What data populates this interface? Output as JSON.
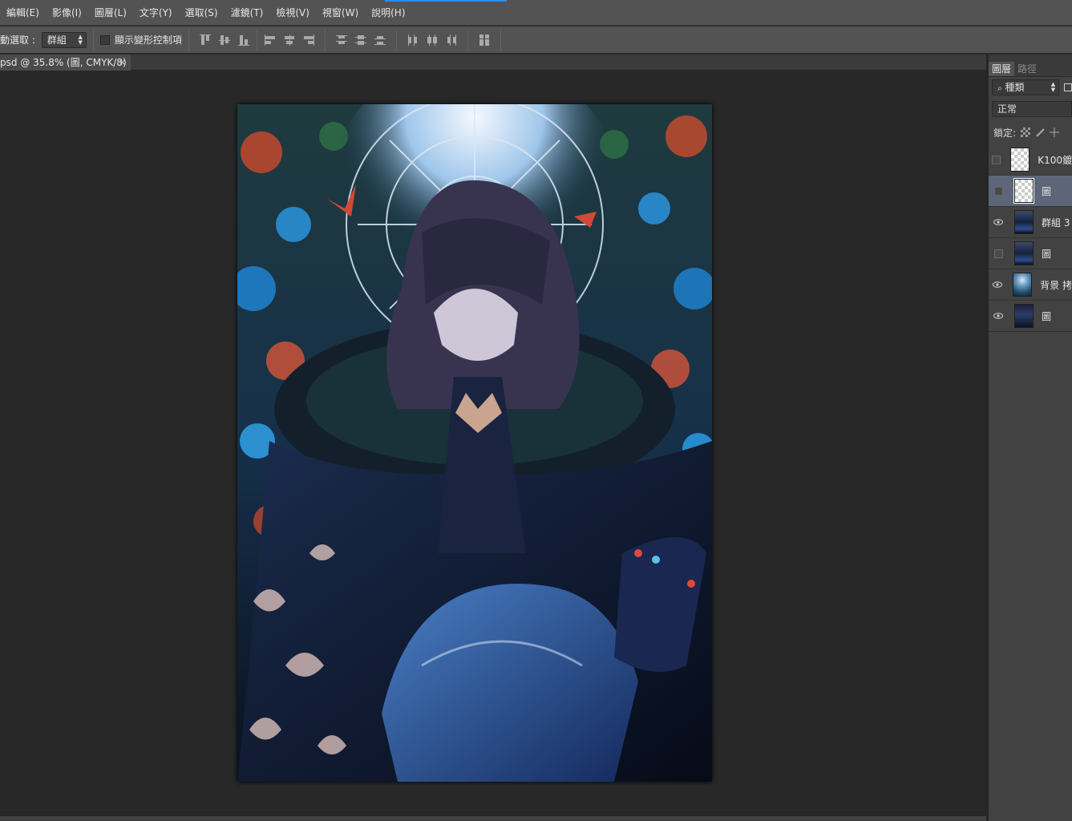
{
  "menu": [
    "編輯(E)",
    "影像(I)",
    "圖層(L)",
    "文字(Y)",
    "選取(S)",
    "濾鏡(T)",
    "檢視(V)",
    "視窗(W)",
    "說明(H)"
  ],
  "options": {
    "auto_select_label": "動選取 :",
    "auto_select_value": "群組",
    "show_transform_label": "顯示變形控制項"
  },
  "document_tab": {
    "title": "psd @ 35.8% (圖, CMYK/8)",
    "close": "×"
  },
  "layers_panel": {
    "tabs": [
      "圖層",
      "路徑"
    ],
    "filter_label": "種類",
    "blend_mode": "正常",
    "lock_label": "鎖定:",
    "layers": [
      {
        "name": "K100鍍",
        "visible": false,
        "thumb": "transparent",
        "selected": false
      },
      {
        "name": "圖",
        "visible": false,
        "thumb": "transparent",
        "selected": true
      },
      {
        "name": "群組 3",
        "visible": true,
        "thumb": "figure",
        "selected": false
      },
      {
        "name": "圖",
        "visible": false,
        "thumb": "figure",
        "selected": false
      },
      {
        "name": "背景 拷",
        "visible": true,
        "thumb": "background",
        "selected": false
      },
      {
        "name": "圖",
        "visible": true,
        "thumb": "figure-dark",
        "selected": false
      }
    ]
  },
  "colors": {
    "chrome": "#535353",
    "canvas": "#282828",
    "panel": "#424242",
    "selection": "#5d6678",
    "accent": "#2d8ceb"
  }
}
